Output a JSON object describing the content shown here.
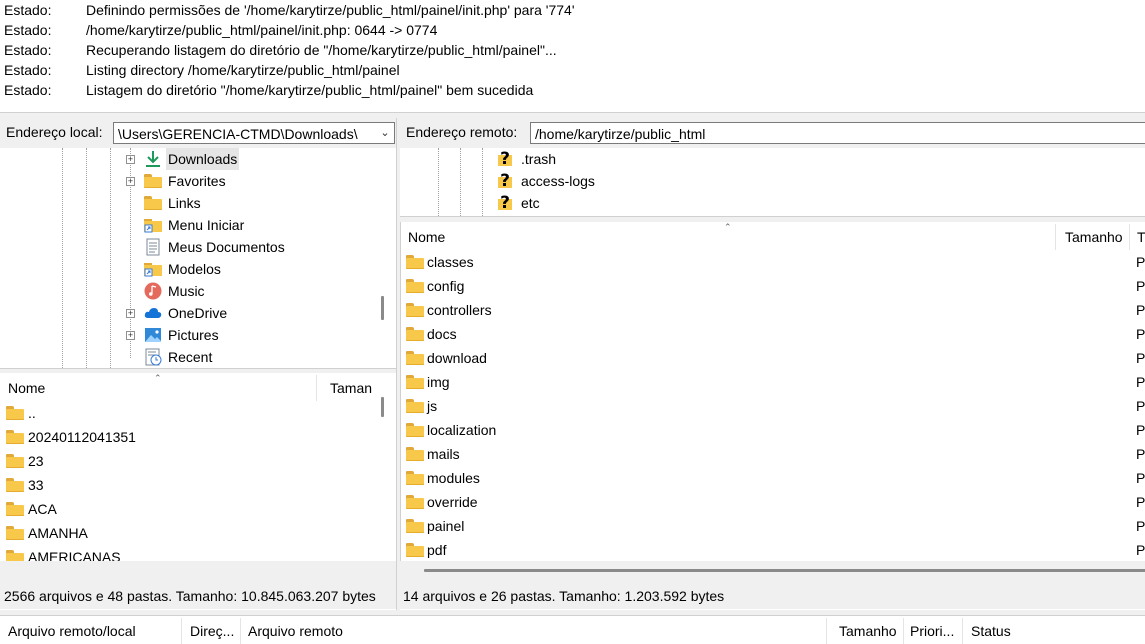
{
  "log": {
    "rows": [
      {
        "label": "Estado:",
        "text": "Definindo permissões de '/home/karytirze/public_html/painel/init.php' para '774'"
      },
      {
        "label": "Estado:",
        "text": "/home/karytirze/public_html/painel/init.php: 0644 -> 0774"
      },
      {
        "label": "Estado:",
        "text": "Recuperando listagem do diretório de \"/home/karytirze/public_html/painel\"..."
      },
      {
        "label": "Estado:",
        "text": "Listing directory /home/karytirze/public_html/painel"
      },
      {
        "label": "Estado:",
        "text": "Listagem do diretório \"/home/karytirze/public_html/painel\" bem sucedida"
      }
    ]
  },
  "local": {
    "address_label": "Endereço local:",
    "address_value": "\\Users\\GERENCIA-CTMD\\Downloads\\",
    "tree": [
      {
        "label": "Downloads",
        "icon": "download-arrow-icon",
        "expander": "+",
        "selected": true
      },
      {
        "label": "Favorites",
        "icon": "folder-icon",
        "expander": "+"
      },
      {
        "label": "Links",
        "icon": "folder-icon",
        "expander": ""
      },
      {
        "label": "Menu Iniciar",
        "icon": "shortcut-folder-icon",
        "expander": ""
      },
      {
        "label": "Meus Documentos",
        "icon": "document-icon",
        "expander": ""
      },
      {
        "label": "Modelos",
        "icon": "shortcut-folder-icon",
        "expander": ""
      },
      {
        "label": "Music",
        "icon": "music-icon",
        "expander": ""
      },
      {
        "label": "OneDrive",
        "icon": "cloud-icon",
        "expander": "+"
      },
      {
        "label": "Pictures",
        "icon": "pictures-icon",
        "expander": "+"
      },
      {
        "label": "Recent",
        "icon": "recent-icon",
        "expander": ""
      }
    ],
    "list_headers": {
      "name": "Nome",
      "size": "Taman"
    },
    "files": [
      "..",
      "20240112041351",
      "23",
      "33",
      "ACA",
      "AMANHA",
      "AMERICANAS"
    ],
    "status": "2566 arquivos e 48 pastas. Tamanho: 10.845.063.207 bytes"
  },
  "remote": {
    "address_label": "Endereço remoto:",
    "address_value": "/home/karytirze/public_html",
    "tree": [
      {
        "label": ".trash",
        "icon": "question-icon"
      },
      {
        "label": "access-logs",
        "icon": "question-icon"
      },
      {
        "label": "etc",
        "icon": "question-icon"
      }
    ],
    "list_headers": {
      "name": "Nome",
      "size": "Tamanho",
      "type": "T"
    },
    "files": [
      "classes",
      "config",
      "controllers",
      "docs",
      "download",
      "img",
      "js",
      "localization",
      "mails",
      "modules",
      "override",
      "painel",
      "pdf"
    ],
    "type_cut": "Pa",
    "status": "14 arquivos e 26 pastas. Tamanho: 1.203.592 bytes"
  },
  "queue": {
    "headers": [
      "Arquivo remoto/local",
      "Direç...",
      "Arquivo remoto",
      "Tamanho",
      "Priori...",
      "Status"
    ]
  },
  "colors": {
    "folder": "#f8c84a",
    "bar": "#f0f0f0",
    "selection": "#e5e5e5"
  }
}
